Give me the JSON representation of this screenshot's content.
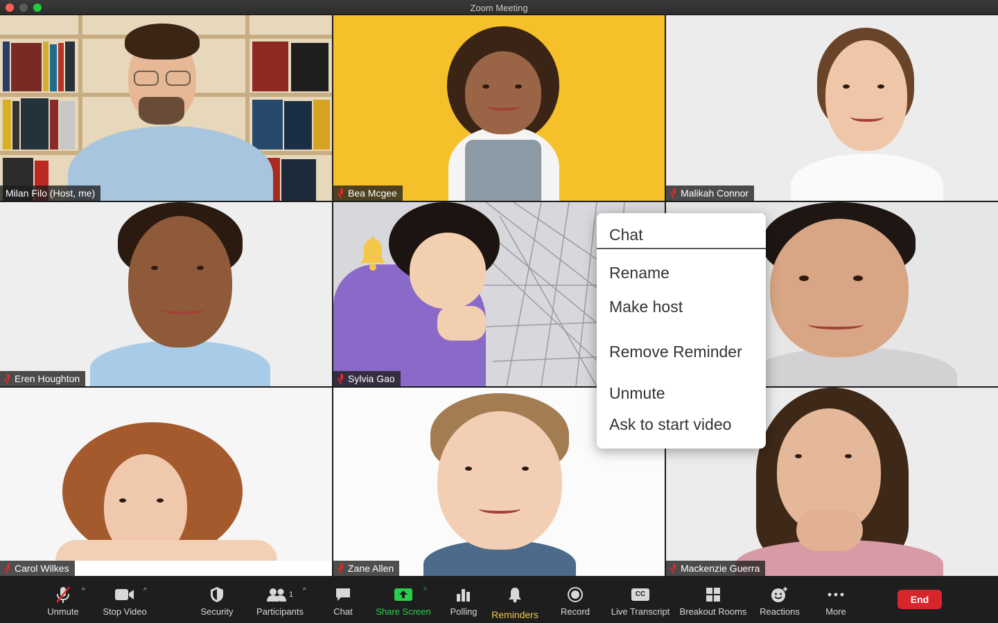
{
  "window": {
    "title": "Zoom Meeting"
  },
  "participants": [
    {
      "name": "Milan Filo (Host, me)",
      "muted": false
    },
    {
      "name": "Bea Mcgee",
      "muted": true
    },
    {
      "name": "Malikah Connor",
      "muted": true
    },
    {
      "name": "Eren Houghton",
      "muted": true
    },
    {
      "name": "Sylvia Gao",
      "muted": true
    },
    {
      "name": "",
      "muted": true
    },
    {
      "name": "Carol Wilkes",
      "muted": true
    },
    {
      "name": "Zane Allen",
      "muted": true
    },
    {
      "name": "Mackenzie Guerra",
      "muted": true
    }
  ],
  "context_menu": {
    "items": [
      "Chat",
      "Rename",
      "Make host",
      "Remove Reminder",
      "Unmute",
      "Ask to start video"
    ]
  },
  "toolbar": {
    "unmute": "Unmute",
    "stop_video": "Stop Video",
    "security": "Security",
    "participants": "Participants",
    "participants_count": "1",
    "chat": "Chat",
    "share_screen": "Share Screen",
    "polling": "Polling",
    "reminders": "Reminders",
    "record": "Record",
    "live_transcript": "Live Transcript",
    "live_transcript_icon_text": "CC",
    "breakout_rooms": "Breakout Rooms",
    "reactions": "Reactions",
    "more": "More",
    "end": "End"
  },
  "colors": {
    "accent_green": "#26d04a",
    "reminders_yellow": "#f3c84a",
    "end_red": "#d6262c",
    "mic_off_red": "#e02828"
  }
}
